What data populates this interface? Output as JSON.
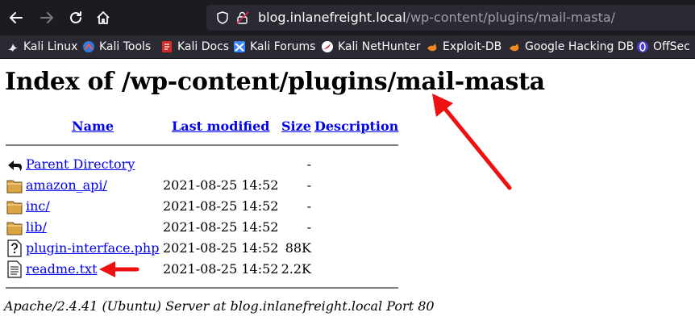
{
  "browser": {
    "url_host": "blog.inlanefreight.local",
    "url_path": "/wp-content/plugins/mail-masta/",
    "bookmarks": [
      {
        "label": "Kali Linux",
        "icon": "kali-dragon-icon"
      },
      {
        "label": "Kali Tools",
        "icon": "kali-tools-icon"
      },
      {
        "label": "Kali Docs",
        "icon": "kali-docs-icon"
      },
      {
        "label": "Kali Forums",
        "icon": "kali-forums-icon"
      },
      {
        "label": "Kali NetHunter",
        "icon": "nethunter-icon"
      },
      {
        "label": "Exploit-DB",
        "icon": "exploit-db-icon"
      },
      {
        "label": "Google Hacking DB",
        "icon": "ghdb-icon"
      },
      {
        "label": "OffSec",
        "icon": "offsec-icon"
      }
    ]
  },
  "page": {
    "title": "Index of /wp-content/plugins/mail-masta",
    "headers": {
      "name": "Name",
      "modified": "Last modified",
      "size": "Size",
      "description": "Description"
    },
    "rows": [
      {
        "name": "Parent Directory",
        "modified": "",
        "size": "-",
        "icon": "back-arrow-icon"
      },
      {
        "name": "amazon_api/",
        "modified": "2021-08-25 14:52",
        "size": "-",
        "icon": "folder-icon"
      },
      {
        "name": "inc/",
        "modified": "2021-08-25 14:52",
        "size": "-",
        "icon": "folder-icon"
      },
      {
        "name": "lib/",
        "modified": "2021-08-25 14:52",
        "size": "-",
        "icon": "folder-icon"
      },
      {
        "name": "plugin-interface.php",
        "modified": "2021-08-25 14:52",
        "size": "88K",
        "icon": "unknown-file-icon"
      },
      {
        "name": "readme.txt",
        "modified": "2021-08-25 14:52",
        "size": "2.2K",
        "icon": "text-file-icon"
      }
    ],
    "address": "Apache/2.4.41 (Ubuntu) Server at blog.inlanefreight.local Port 80"
  },
  "colors": {
    "annotation_arrow": "#ee1111",
    "link": "#0000ee",
    "chrome_dark": "#1c1b22"
  }
}
